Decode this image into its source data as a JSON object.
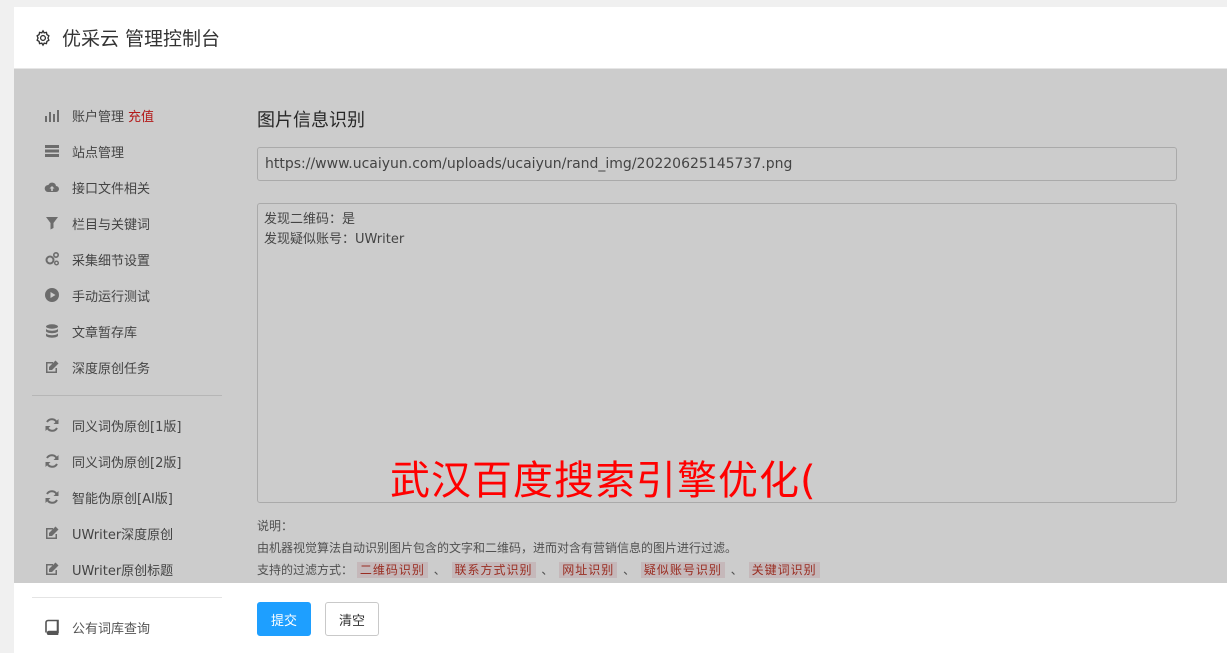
{
  "header": {
    "title": "优采云 管理控制台"
  },
  "sidebar": {
    "group1": [
      {
        "label": "账户管理",
        "badge": "充值"
      },
      {
        "label": "站点管理"
      },
      {
        "label": "接口文件相关"
      },
      {
        "label": "栏目与关键词"
      },
      {
        "label": "采集细节设置"
      },
      {
        "label": "手动运行测试"
      },
      {
        "label": "文章暂存库"
      },
      {
        "label": "深度原创任务"
      }
    ],
    "group2": [
      {
        "label": "同义词伪原创[1版]"
      },
      {
        "label": "同义词伪原创[2版]"
      },
      {
        "label": "智能伪原创[AI版]"
      },
      {
        "label": "UWriter深度原创"
      },
      {
        "label": "UWriter原创标题"
      }
    ],
    "group3": [
      {
        "label": "公有词库查询"
      }
    ]
  },
  "main": {
    "title": "图片信息识别",
    "url_value": "https://www.ucaiyun.com/uploads/ucaiyun/rand_img/20220625145737.png",
    "result_lines": [
      "发现二维码：是",
      "发现疑似账号：UWriter"
    ],
    "notes": {
      "label": "说明：",
      "desc": "由机器视觉算法自动识别图片包含的文字和二维码，进而对含有营销信息的图片进行过滤。",
      "filters_label": "支持的过滤方式：",
      "filters": [
        "二维码识别",
        "联系方式识别",
        "网址识别",
        "疑似账号识别",
        "关键词识别"
      ],
      "separator": "、"
    },
    "buttons": {
      "submit": "提交",
      "clear": "清空"
    }
  },
  "watermark": "武汉百度搜索引擎优化(",
  "colors": {
    "primary": "#1e9fff",
    "badge": "#e02020",
    "watermark": "#ff0000"
  }
}
